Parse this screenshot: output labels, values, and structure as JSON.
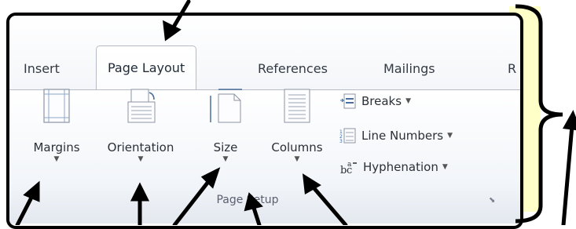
{
  "tabs": [
    {
      "label": "Insert",
      "active": false
    },
    {
      "label": "Page Layout",
      "active": true
    },
    {
      "label": "References",
      "active": false
    },
    {
      "label": "Mailings",
      "active": false
    },
    {
      "label": "R",
      "active": false
    }
  ],
  "page_setup": {
    "group_label": "Page Setup",
    "margins": "Margins",
    "orientation": "Orientation",
    "size": "Size",
    "columns": "Columns",
    "breaks": "Breaks",
    "line_numbers": "Line Numbers",
    "hyphenation": "Hyphenation"
  },
  "icons": {
    "dropdown": "dropdown-caret-icon",
    "launcher": "dialog-launcher-icon"
  },
  "colors": {
    "annotation": "#000000",
    "highlight": "#ffffc8",
    "ribbon_border": "#b6bcc6"
  }
}
